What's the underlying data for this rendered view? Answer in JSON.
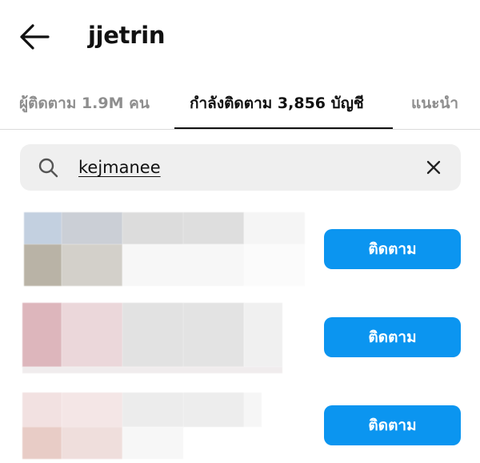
{
  "header": {
    "title": "jjetrin"
  },
  "tabs": [
    {
      "label": "ผู้ติดตาม 1.9M คน",
      "active": false
    },
    {
      "label": "กำลังติดตาม 3,856 บัญชี",
      "active": true
    },
    {
      "label": "แนะนำ",
      "active": false
    }
  ],
  "search": {
    "value": "kejmanee"
  },
  "results": [
    {
      "follow_label": "ติดตาม"
    },
    {
      "follow_label": "ติดตาม"
    },
    {
      "follow_label": "ติดตาม"
    }
  ],
  "colors": {
    "follow_button": "#0b95f0",
    "search_background": "#efefef",
    "inactive_tab": "#8e8e8e",
    "active_indicator": "#111111"
  },
  "icons": [
    "back-arrow-icon",
    "search-icon",
    "clear-icon"
  ]
}
